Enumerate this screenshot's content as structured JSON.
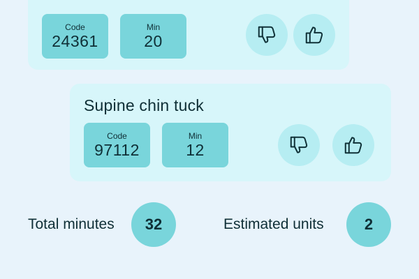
{
  "exercises": [
    {
      "name": "",
      "code_label": "Code",
      "code": "24361",
      "min_label": "Min",
      "min": "20"
    },
    {
      "name": "Supine chin tuck",
      "code_label": "Code",
      "code": "97112",
      "min_label": "Min",
      "min": "12"
    }
  ],
  "icons": {
    "dislike": "thumbs-down-icon",
    "like": "thumbs-up-icon"
  },
  "summary": {
    "total_minutes_label": "Total minutes",
    "total_minutes": "32",
    "estimated_units_label": "Estimated units",
    "estimated_units": "2"
  },
  "colors": {
    "background": "#E8F3FB",
    "card": "#D7F6FA",
    "stat_box": "#79D5DB",
    "vote_button": "#B6EDF2",
    "text": "#0F2F36"
  }
}
